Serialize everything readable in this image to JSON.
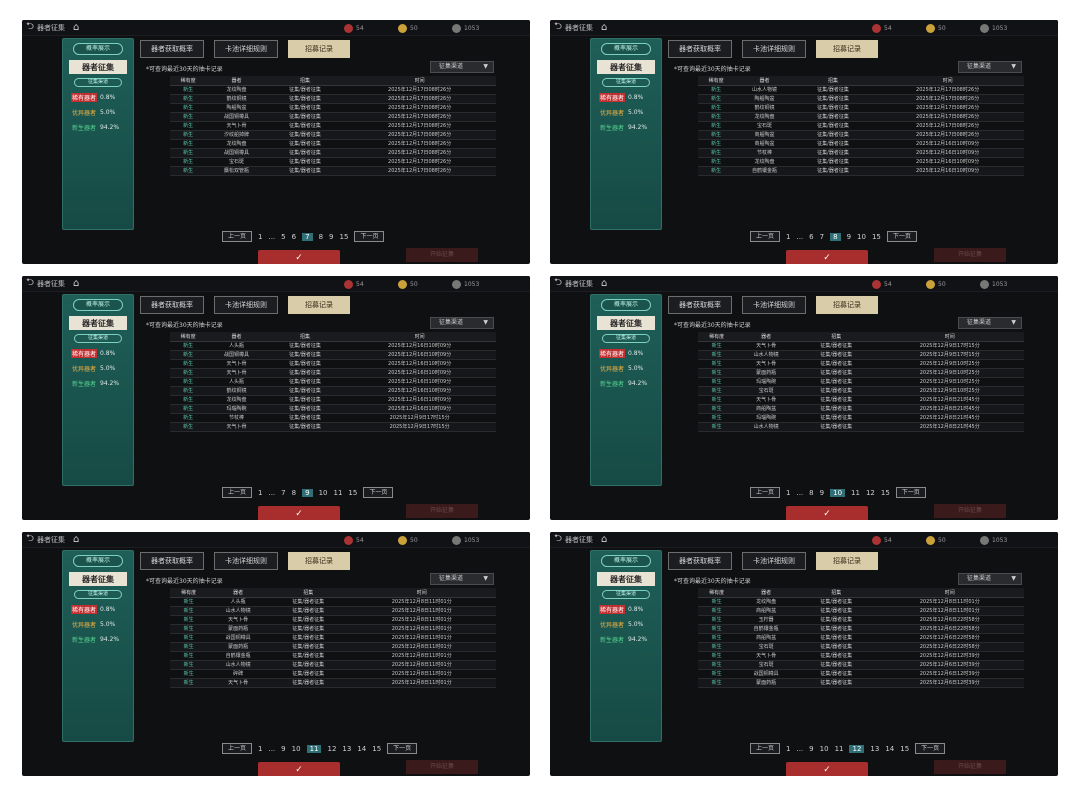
{
  "common": {
    "top_title": "器者征集",
    "resource_values": [
      "54",
      "50",
      "1053"
    ],
    "side_tag": "概率展示",
    "side_title": "器者征集",
    "side_filter": "征集渠道",
    "rates": [
      {
        "label": "稀有器者",
        "value": "0.8%"
      },
      {
        "label": "优异器者",
        "value": "5.0%"
      },
      {
        "label": "新生器者",
        "value": "94.2%"
      }
    ],
    "tabs": [
      "器者获取概率",
      "卡池详细规则",
      "招募记录"
    ],
    "note": "*可查询最近30天的抽卡记录",
    "dropdown": "征集渠道",
    "columns": [
      "稀有度",
      "器者",
      "招集",
      "时间"
    ],
    "prev": "上一页",
    "next": "下一页",
    "ellipsis": "...",
    "confirm": "✓",
    "start": "开始征集"
  },
  "panels": [
    {
      "first_page": "1",
      "pages": [
        "5",
        "6",
        "7",
        "8",
        "9"
      ],
      "current_page": "7",
      "last_page": "15",
      "rows": [
        [
          "新生",
          "龙纹陶盘",
          "征集/器者征集",
          "2025年12月17日08时26分"
        ],
        [
          "新生",
          "鹤纹铜镜",
          "征集/器者征集",
          "2025年12月17日08时26分"
        ],
        [
          "新生",
          "陶船陶盆",
          "征集/器者征集",
          "2025年12月17日08时26分"
        ],
        [
          "新生",
          "战国铜樽具",
          "征集/器者征集",
          "2025年12月17日08时26分"
        ],
        [
          "新生",
          "天气卜骨",
          "征集/器者征集",
          "2025年12月17日08时26分"
        ],
        [
          "新生",
          "汐纹船掉牌",
          "征集/器者征集",
          "2025年12月17日08时26分"
        ],
        [
          "新生",
          "龙纹陶盘",
          "征集/器者征集",
          "2025年12月17日08时26分"
        ],
        [
          "新生",
          "战国铜樽具",
          "征集/器者征集",
          "2025年12月17日08时26分"
        ],
        [
          "新生",
          "宝石斑",
          "征集/器者征集",
          "2025年12月17日08时26分"
        ],
        [
          "新生",
          "麋松双管瓶",
          "征集/器者征集",
          "2025年12月17日08时26分"
        ]
      ]
    },
    {
      "first_page": "1",
      "pages": [
        "6",
        "7",
        "8",
        "9",
        "10"
      ],
      "current_page": "8",
      "last_page": "15",
      "rows": [
        [
          "新生",
          "山水人物镜",
          "征集/器者征集",
          "2025年12月17日08时26分"
        ],
        [
          "新生",
          "陶船陶盆",
          "征集/器者征集",
          "2025年12月17日08时26分"
        ],
        [
          "新生",
          "鹤纹铜镜",
          "征集/器者征集",
          "2025年12月17日08时26分"
        ],
        [
          "新生",
          "龙纹陶盘",
          "征集/器者征集",
          "2025年12月17日08时26分"
        ],
        [
          "新生",
          "宝石斑",
          "征集/器者征集",
          "2025年12月17日08时26分"
        ],
        [
          "新生",
          "商船陶盆",
          "征集/器者征集",
          "2025年12月17日08时26分"
        ],
        [
          "新生",
          "商船陶盆",
          "征集/器者征集",
          "2025年12月16日10时09分"
        ],
        [
          "新生",
          "节杖棒",
          "征集/器者征集",
          "2025年12月16日10时09分"
        ],
        [
          "新生",
          "龙纹陶盘",
          "征集/器者征集",
          "2025年12月16日10时09分"
        ],
        [
          "新生",
          "自鹤镶金瓶",
          "征集/器者征集",
          "2025年12月16日10时09分"
        ]
      ]
    },
    {
      "first_page": "1",
      "pages": [
        "7",
        "8",
        "9",
        "10",
        "11"
      ],
      "current_page": "9",
      "last_page": "15",
      "rows": [
        [
          "新生",
          "人头瓶",
          "征集/器者征集",
          "2025年12月16日10时09分"
        ],
        [
          "新生",
          "战国铜樽具",
          "征集/器者征集",
          "2025年12月16日10时09分"
        ],
        [
          "新生",
          "天气卜骨",
          "征集/器者征集",
          "2025年12月16日10时09分"
        ],
        [
          "新生",
          "天气卜骨",
          "征集/器者征集",
          "2025年12月16日10时09分"
        ],
        [
          "新生",
          "人头瓶",
          "征集/器者征集",
          "2025年12月16日10时09分"
        ],
        [
          "新生",
          "鹤纹铜镜",
          "征集/器者征集",
          "2025年12月16日10时09分"
        ],
        [
          "新生",
          "龙纹陶盘",
          "征集/器者征集",
          "2025年12月16日10时09分"
        ],
        [
          "新生",
          "玛瑙陶碗",
          "征集/器者征集",
          "2025年12月16日10时09分"
        ],
        [
          "新生",
          "节杖棒",
          "征集/器者征集",
          "2025年12月9日17时15分"
        ],
        [
          "新生",
          "天气卜骨",
          "征集/器者征集",
          "2025年12月9日17时15分"
        ]
      ]
    },
    {
      "first_page": "1",
      "pages": [
        "8",
        "9",
        "10",
        "11",
        "12"
      ],
      "current_page": "10",
      "last_page": "15",
      "rows": [
        [
          "新生",
          "天气卜骨",
          "征集/器者征集",
          "2025年12月9日17时15分"
        ],
        [
          "新生",
          "山水人物镜",
          "征集/器者征集",
          "2025年12月9日17时15分"
        ],
        [
          "新生",
          "天气卜骨",
          "征集/器者征集",
          "2025年12月9日10时25分"
        ],
        [
          "新生",
          "蒙面药瓶",
          "征集/器者征集",
          "2025年12月9日10时25分"
        ],
        [
          "新生",
          "玛瑙陶碗",
          "征集/器者征集",
          "2025年12月9日10时25分"
        ],
        [
          "新生",
          "宝石斑",
          "征集/器者征集",
          "2025年12月9日10时25分"
        ],
        [
          "新生",
          "天气卜骨",
          "征集/器者征集",
          "2025年12月8日21时45分"
        ],
        [
          "新生",
          "商船陶盆",
          "征集/器者征集",
          "2025年12月8日21时45分"
        ],
        [
          "新生",
          "玛瑙陶碗",
          "征集/器者征集",
          "2025年12月8日21时45分"
        ],
        [
          "新生",
          "山水人物镜",
          "征集/器者征集",
          "2025年12月8日21时45分"
        ]
      ]
    },
    {
      "first_page": "1",
      "pages": [
        "9",
        "10",
        "11",
        "12",
        "13",
        "14"
      ],
      "current_page": "11",
      "last_page": "15",
      "rows": [
        [
          "新生",
          "人头瓶",
          "征集/器者征集",
          "2025年12月8日11时01分"
        ],
        [
          "新生",
          "山水人物镜",
          "征集/器者征集",
          "2025年12月8日11时01分"
        ],
        [
          "新生",
          "天气卜骨",
          "征集/器者征集",
          "2025年12月8日11时01分"
        ],
        [
          "新生",
          "蒙面药瓶",
          "征集/器者征集",
          "2025年12月8日11时01分"
        ],
        [
          "新生",
          "战国铜樽具",
          "征集/器者征集",
          "2025年12月8日11时01分"
        ],
        [
          "新生",
          "蒙面药瓶",
          "征集/器者征集",
          "2025年12月8日11时01分"
        ],
        [
          "新生",
          "自鹤镶金瓶",
          "征集/器者征集",
          "2025年12月8日11时01分"
        ],
        [
          "新生",
          "山水人物镜",
          "征集/器者征集",
          "2025年12月8日11时01分"
        ],
        [
          "新生",
          "碎碑",
          "征集/器者征集",
          "2025年12月8日11时01分"
        ],
        [
          "新生",
          "天气卜骨",
          "征集/器者征集",
          "2025年12月8日11时01分"
        ]
      ]
    },
    {
      "first_page": "1",
      "pages": [
        "9",
        "10",
        "11",
        "12",
        "13",
        "14"
      ],
      "current_page": "12",
      "last_page": "15",
      "rows": [
        [
          "新生",
          "龙纹陶盘",
          "征集/器者征集",
          "2025年12月8日11时01分"
        ],
        [
          "新生",
          "商船陶盆",
          "征集/器者征集",
          "2025年12月8日11时01分"
        ],
        [
          "新生",
          "玉柠器",
          "征集/器者征集",
          "2025年12月6日22时58分"
        ],
        [
          "新生",
          "自鹤镶金瓶",
          "征集/器者征集",
          "2025年12月6日22时58分"
        ],
        [
          "新生",
          "商船陶盆",
          "征集/器者征集",
          "2025年12月6日22时58分"
        ],
        [
          "新生",
          "宝石斑",
          "征集/器者征集",
          "2025年12月6日22时58分"
        ],
        [
          "新生",
          "天气卜骨",
          "征集/器者征集",
          "2025年12月6日12时39分"
        ],
        [
          "新生",
          "宝石斑",
          "征集/器者征集",
          "2025年12月6日12时39分"
        ],
        [
          "新生",
          "战国铜樽具",
          "征集/器者征集",
          "2025年12月6日12时39分"
        ],
        [
          "新生",
          "蒙面药瓶",
          "征集/器者征集",
          "2025年12月6日12时39分"
        ]
      ]
    }
  ]
}
